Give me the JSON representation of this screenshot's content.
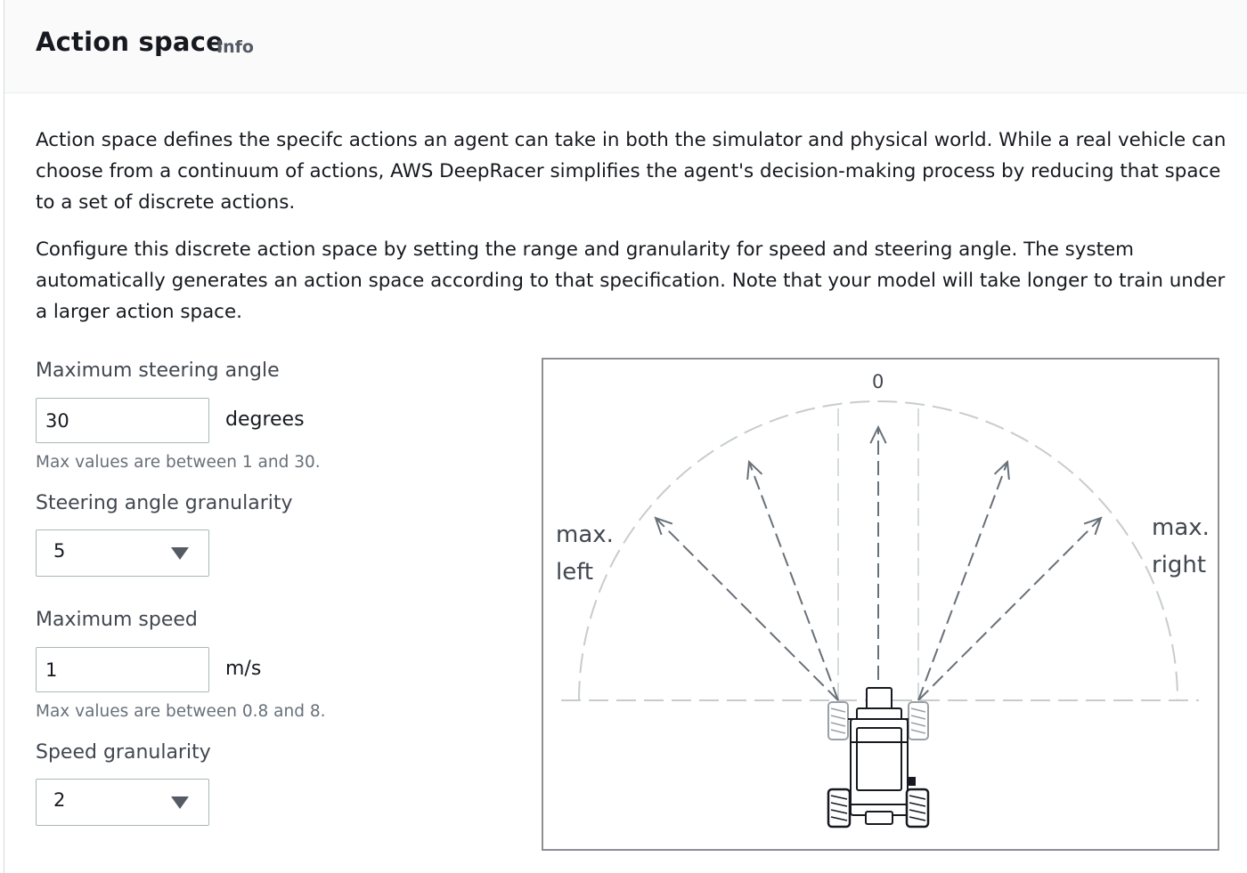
{
  "header": {
    "title": "Action space",
    "info_link": "Info"
  },
  "description": {
    "paragraph_1": "Action space defines the specifc actions an agent can take in both the simulator and physical world. While a real vehicle can choose from a continuum of actions, AWS DeepRacer simplifies the agent's decision-making process by reducing that space to a set of discrete actions.",
    "paragraph_2": "Configure this discrete action space by setting the range and granularity for speed and steering angle. The system automatically generates an action space according to that specification. Note that your model will take longer to train under a larger action space."
  },
  "form": {
    "max_steering_angle": {
      "label": "Maximum steering angle",
      "value": "30",
      "unit": "degrees",
      "hint": "Max values are between 1 and 30."
    },
    "steering_granularity": {
      "label": "Steering angle granularity",
      "value": "5"
    },
    "max_speed": {
      "label": "Maximum speed",
      "value": "1",
      "unit": "m/s",
      "hint": "Max values are between 0.8 and 8."
    },
    "speed_granularity": {
      "label": "Speed granularity",
      "value": "2"
    }
  },
  "diagram": {
    "center_label": "0",
    "left_label_line1": "max.",
    "left_label_line2": "left",
    "right_label_line1": "max.",
    "right_label_line2": "right",
    "steering_arrow_count": 5,
    "colors": {
      "arrow": "#687078",
      "guide": "#c8cccc",
      "car": "#16191f"
    }
  },
  "colors": {
    "header_bg": "#fafafa",
    "text": "#16191f",
    "hint": "#687078",
    "border": "#aab7b8"
  }
}
